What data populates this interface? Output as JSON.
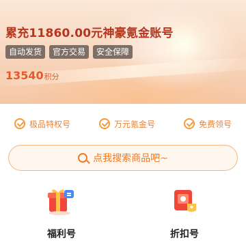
{
  "hero": {
    "title": "累充11860.00元神豪氪金账号",
    "tags": [
      "自动发货",
      "官方交易",
      "安全保障"
    ],
    "points_value": "13540",
    "points_unit": "积分"
  },
  "features": [
    "极品特权号",
    "万元氪金号",
    "免费领号"
  ],
  "search": {
    "placeholder": "点我搜索商品吧~"
  },
  "categories": [
    {
      "label": "福利号",
      "icon": "gift-icon"
    },
    {
      "label": "折扣号",
      "icon": "discount-icon"
    }
  ],
  "colors": {
    "title": "#b5361e",
    "accent": "#ee7a26",
    "tag_bg": "#7e6f66",
    "points": "#e35a2b"
  }
}
